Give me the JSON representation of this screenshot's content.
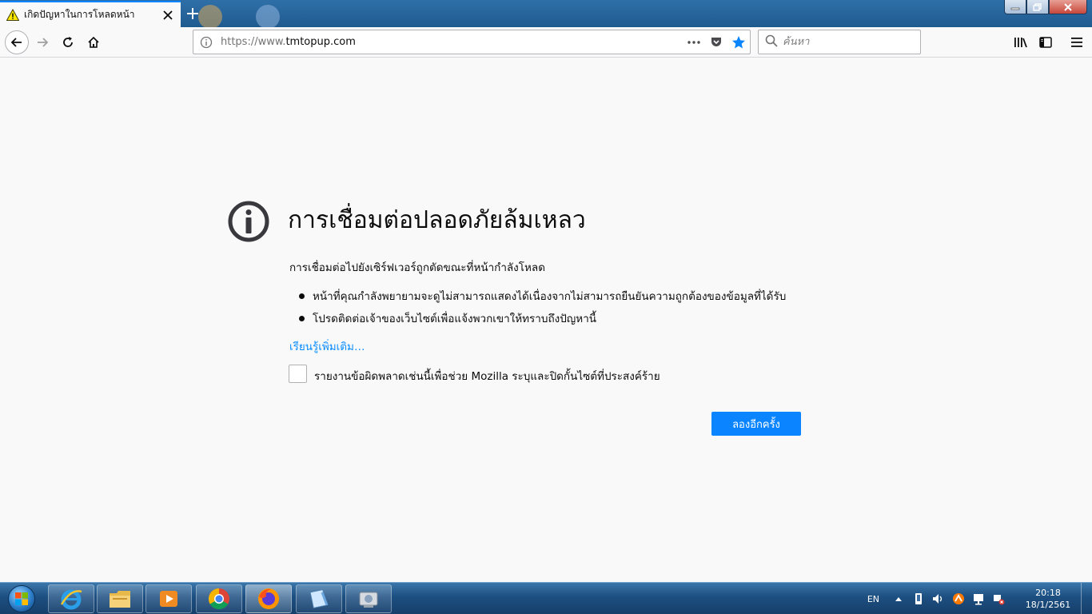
{
  "tab": {
    "title": "เกิดปัญหาในการโหลดหน้า"
  },
  "urlbar": {
    "url_prefix": "https://www.",
    "url_domain": "tmtopup.com"
  },
  "search": {
    "placeholder": "ค้นหา"
  },
  "error": {
    "title": "การเชื่อมต่อปลอดภัยล้มเหลว",
    "description": "การเชื่อมต่อไปยังเซิร์ฟเวอร์ถูกตัดขณะที่หน้ากำลังโหลด",
    "bullets": [
      "หน้าที่คุณกำลังพยายามจะดูไม่สามารถแสดงได้เนื่องจากไม่สามารถยืนยันความถูกต้องของข้อมูลที่ได้รับ",
      "โปรดติดต่อเจ้าของเว็บไซต์เพื่อแจ้งพวกเขาให้ทราบถึงปัญหานี้"
    ],
    "learn_more": "เรียนรู้เพิ่มเติม…",
    "report_label": "รายงานข้อผิดพลาดเช่นนี้เพื่อช่วย Mozilla ระบุและปิดกั้นไซต์ที่ประสงค์ร้าย",
    "retry_label": "ลองอีกครั้ง"
  },
  "taskbar": {
    "language": "EN",
    "time": "20:18",
    "date": "18/1/2561"
  },
  "colors": {
    "accent": "#0a84ff",
    "link": "#0a8dff",
    "page_bg": "#f9f9fa",
    "error_icon": "#38383d"
  }
}
